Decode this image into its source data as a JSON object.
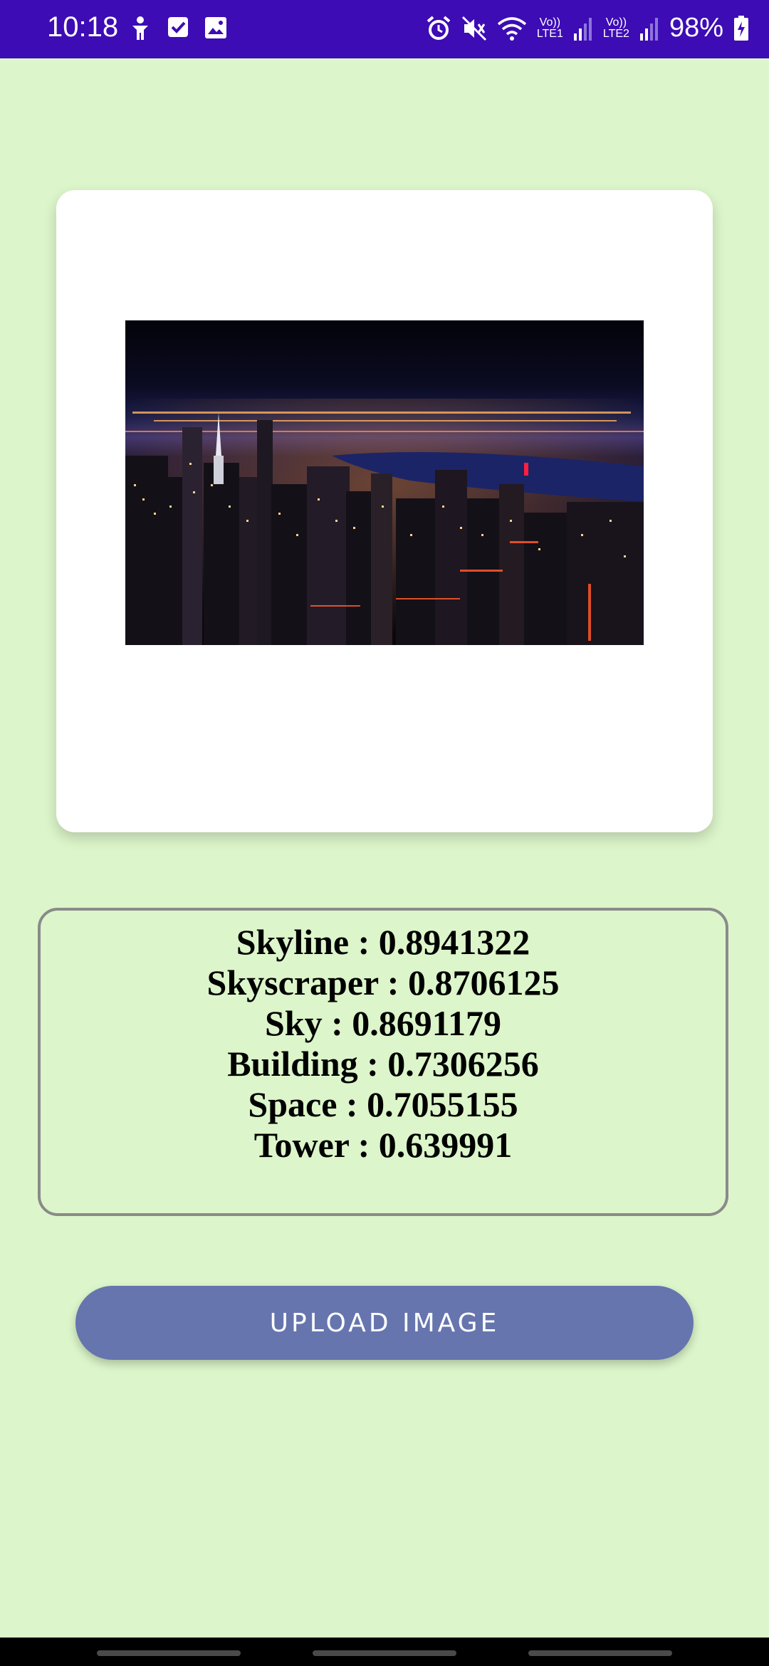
{
  "status_bar": {
    "time": "10:18",
    "battery": "98%",
    "lte1": "LTE1",
    "lte2": "LTE2",
    "volte": "Vo))",
    "icons": [
      "accessibility-icon",
      "check-square-icon",
      "image-icon",
      "alarm-icon",
      "mute-icon",
      "wifi-icon",
      "signal-icon",
      "battery-charging-icon"
    ]
  },
  "image_card": {
    "image": "city-skyline-night-photo"
  },
  "results": [
    "Skyline : 0.8941322",
    "Skyscraper : 0.8706125",
    "Sky : 0.8691179",
    "Building : 0.7306256",
    "Space : 0.7055155",
    "Tower : 0.639991"
  ],
  "upload_button": {
    "label": "UPLOAD IMAGE"
  },
  "colors": {
    "status_bar": "#3d0cb5",
    "background": "#dcf5ca",
    "button": "#6675ad"
  }
}
